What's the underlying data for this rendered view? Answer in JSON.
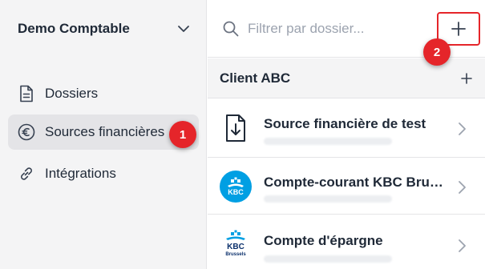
{
  "sidebar": {
    "org_name": "Demo Comptable",
    "items": [
      {
        "label": "Dossiers",
        "icon": "document-icon",
        "active": false
      },
      {
        "label": "Sources financières",
        "icon": "euro-icon",
        "active": true
      },
      {
        "label": "Intégrations",
        "icon": "link-icon",
        "active": false
      }
    ]
  },
  "badges": {
    "first": "1",
    "second": "2"
  },
  "search": {
    "placeholder": "Filtrer par dossier...",
    "value": ""
  },
  "group": {
    "title": "Client ABC"
  },
  "sources": [
    {
      "title": "Source financière de test",
      "icon": "download-document-icon"
    },
    {
      "title": "Compte-courant KBC Brus...",
      "icon": "kbc-logo-icon"
    },
    {
      "title": "Compte d'épargne",
      "icon": "kbc-brussels-logo-icon",
      "logo_text": "Brussels"
    }
  ],
  "colors": {
    "accent_red": "#e5252a",
    "kbc_blue": "#009fe3",
    "sidebar_bg": "#f4f4f5"
  }
}
